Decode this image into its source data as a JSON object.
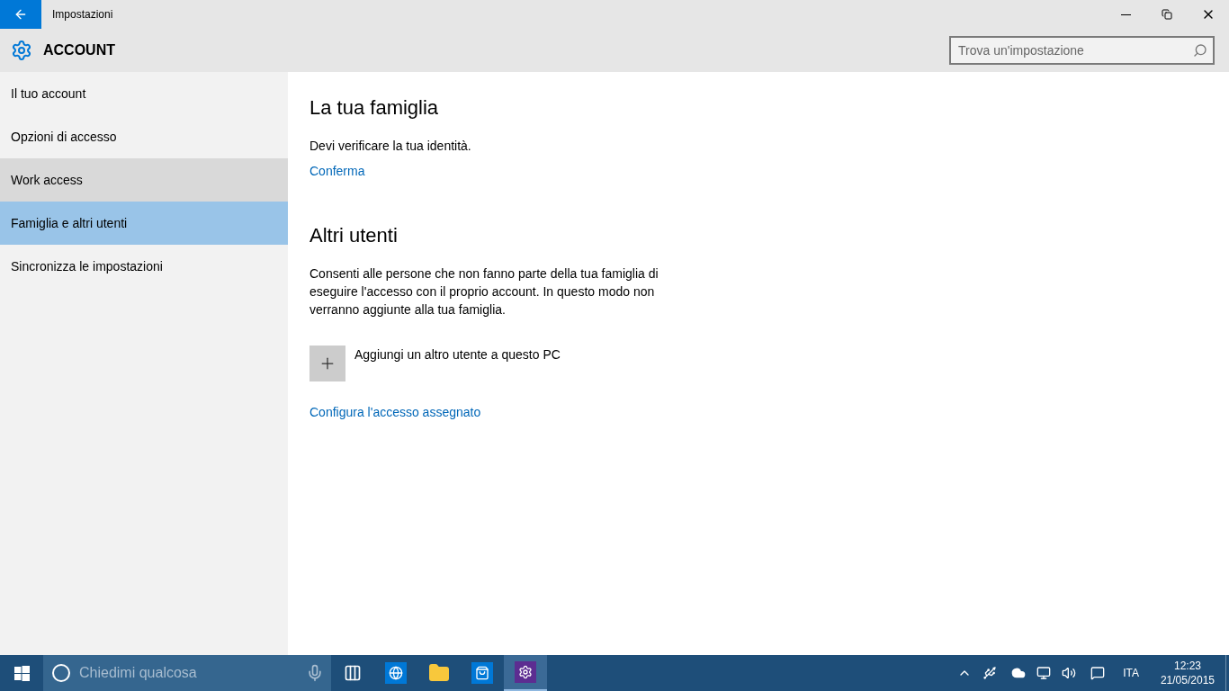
{
  "window": {
    "title": "Impostazioni"
  },
  "header": {
    "title": "ACCOUNT",
    "search": {
      "placeholder": "Trova un'impostazione"
    }
  },
  "sidebar": {
    "items": [
      {
        "label": "Il tuo account",
        "selected": false,
        "hovered": false
      },
      {
        "label": "Opzioni di accesso",
        "selected": false,
        "hovered": false
      },
      {
        "label": "Work access",
        "selected": false,
        "hovered": true
      },
      {
        "label": "Famiglia e altri utenti",
        "selected": true,
        "hovered": false
      },
      {
        "label": "Sincronizza le impostazioni",
        "selected": false,
        "hovered": false
      }
    ]
  },
  "family": {
    "heading": "La tua famiglia",
    "text": "Devi verificare la tua identità.",
    "link": "Conferma"
  },
  "others": {
    "heading": "Altri utenti",
    "text": "Consenti alle persone che non fanno parte della tua famiglia di eseguire l'accesso con il proprio account. In questo modo non verranno aggiunte alla tua famiglia.",
    "add_label": "Aggiungi un altro utente a questo PC",
    "link": "Configura l'accesso assegnato"
  },
  "taskbar": {
    "search_placeholder": "Chiedimi qualcosa",
    "apps": [
      {
        "kind": "taskview",
        "selected": false
      },
      {
        "kind": "browser",
        "selected": false
      },
      {
        "kind": "explorer",
        "selected": false
      },
      {
        "kind": "store",
        "selected": false
      },
      {
        "kind": "settings",
        "selected": true
      }
    ],
    "language": "ITA",
    "time": "12:23",
    "date": "21/05/2015"
  }
}
